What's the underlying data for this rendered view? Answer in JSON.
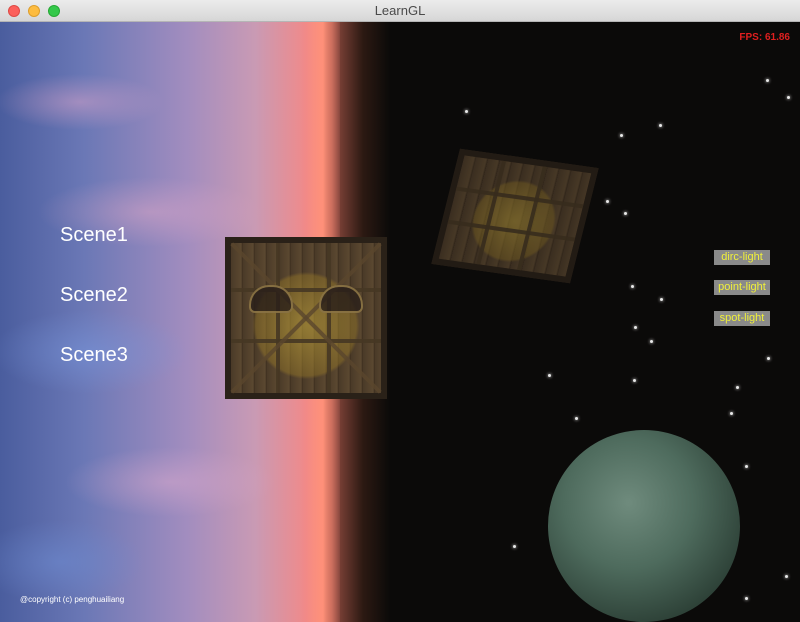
{
  "window": {
    "title": "LearnGL"
  },
  "hud": {
    "fps": "FPS: 61.86"
  },
  "scenes": [
    {
      "label": "Scene1"
    },
    {
      "label": "Scene2"
    },
    {
      "label": "Scene3"
    }
  ],
  "lights": [
    {
      "label": "dirc-light"
    },
    {
      "label": "point-light"
    },
    {
      "label": "spot-light"
    }
  ],
  "footer": {
    "copyright": "@copyright (c) penghuailiang"
  },
  "colors": {
    "fps_text": "#e01f1f",
    "light_button_bg": "#8a8a8a",
    "light_button_text": "#f0f03a",
    "scene_text": "#ffffff"
  },
  "icons": {
    "close": "close-icon",
    "minimize": "minimize-icon",
    "zoom": "zoom-icon"
  }
}
